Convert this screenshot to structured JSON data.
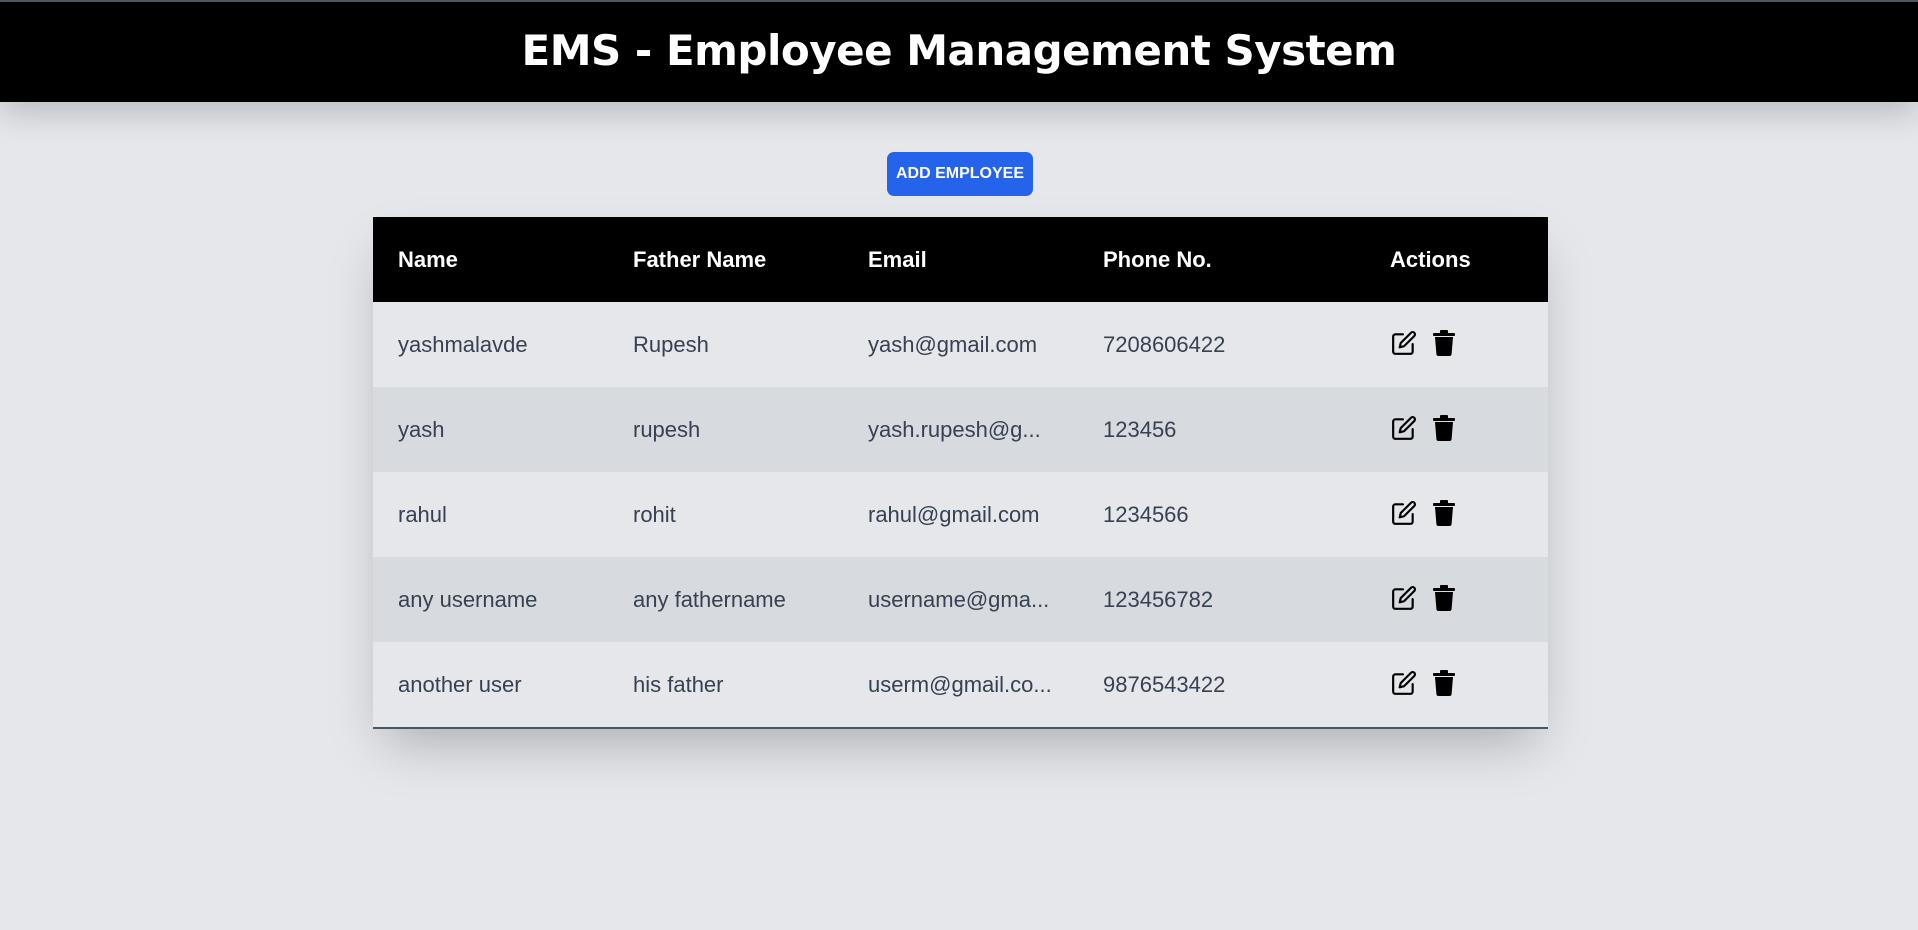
{
  "header": {
    "title": "EMS - Employee Management System"
  },
  "toolbar": {
    "add_label": "ADD EMPLOYEE"
  },
  "table": {
    "columns": [
      "Name",
      "Father Name",
      "Email",
      "Phone No.",
      "Actions"
    ],
    "rows": [
      {
        "name": "yashmalavde",
        "father": "Rupesh",
        "email": "yash@gmail.com",
        "phone": "7208606422"
      },
      {
        "name": "yash",
        "father": "rupesh",
        "email": "yash.rupesh@g...",
        "phone": "123456"
      },
      {
        "name": "rahul",
        "father": "rohit",
        "email": "rahul@gmail.com",
        "phone": "1234566"
      },
      {
        "name": "any username",
        "father": "any fathername",
        "email": "username@gma...",
        "phone": "123456782"
      },
      {
        "name": "another user",
        "father": "his father",
        "email": "userm@gmail.co...",
        "phone": "9876543422"
      }
    ],
    "row_actions": [
      "edit-icon",
      "trash-icon"
    ]
  },
  "colors": {
    "header_bg": "#000000",
    "page_bg": "#e5e7eb",
    "button_bg": "#2563eb",
    "row_alt_bg": "#d7dade",
    "cell_text": "#374151"
  }
}
